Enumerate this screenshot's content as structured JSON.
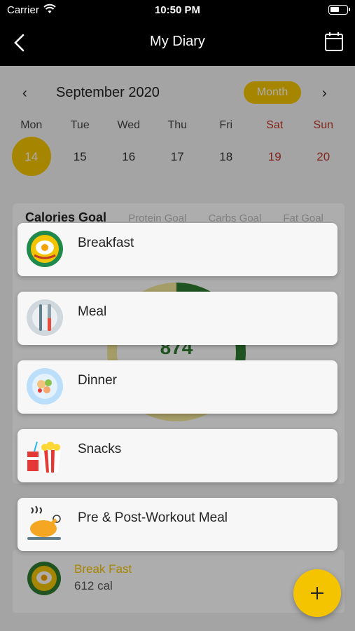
{
  "status": {
    "carrier": "Carrier",
    "time": "10:50 PM"
  },
  "nav": {
    "title": "My Diary"
  },
  "calendar": {
    "month_label": "September 2020",
    "mode_label": "Month",
    "days": [
      {
        "name": "Mon",
        "num": "14"
      },
      {
        "name": "Tue",
        "num": "15"
      },
      {
        "name": "Wed",
        "num": "16"
      },
      {
        "name": "Thu",
        "num": "17"
      },
      {
        "name": "Fri",
        "num": "18"
      },
      {
        "name": "Sat",
        "num": "19"
      },
      {
        "name": "Sun",
        "num": "20"
      }
    ]
  },
  "goals": {
    "tabs": [
      "Calories Goal",
      "Protein Goal",
      "Carbs Goal",
      "Fat Goal"
    ],
    "value": "874"
  },
  "entry": {
    "name": "Break Fast",
    "calories": "612 cal"
  },
  "sheet": {
    "items": [
      {
        "label": "Breakfast",
        "icon": "breakfast-plate-icon"
      },
      {
        "label": "Meal",
        "icon": "fork-knife-icon"
      },
      {
        "label": "Dinner",
        "icon": "salad-plate-icon"
      },
      {
        "label": "Snacks",
        "icon": "popcorn-soda-icon"
      },
      {
        "label": "Pre & Post-Workout Meal",
        "icon": "roast-chicken-icon"
      }
    ]
  },
  "colors": {
    "accent": "#f5c400",
    "weekend": "#c0392b",
    "ring": "#2e7d32"
  }
}
